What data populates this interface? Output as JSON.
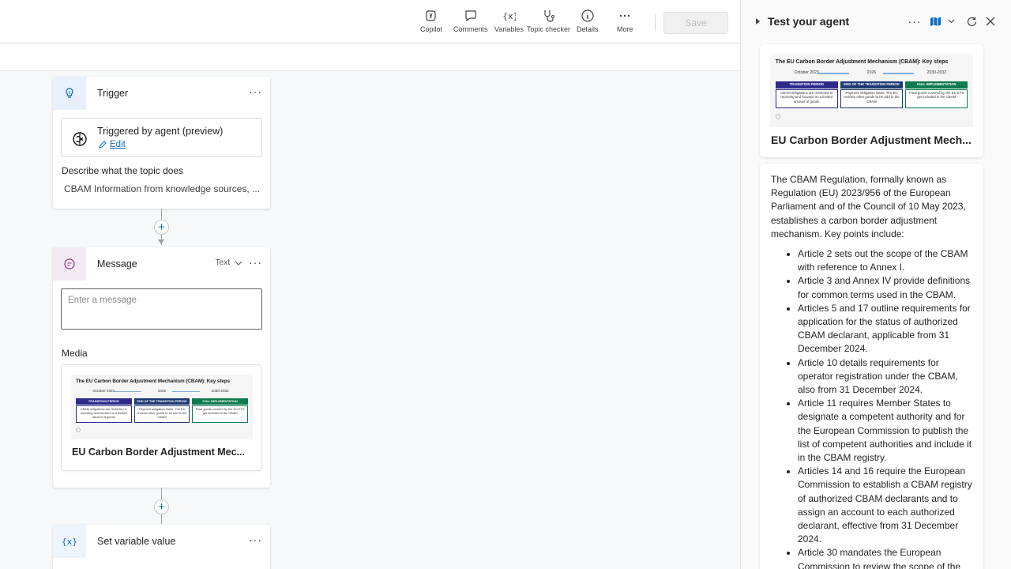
{
  "toolbar": {
    "copilot": "Copilot",
    "comments": "Comments",
    "variables": "Variables",
    "topic_checker": "Topic checker",
    "details": "Details",
    "more": "More",
    "save": "Save"
  },
  "trigger_node": {
    "title": "Trigger",
    "trigger_text": "Triggered by agent (preview)",
    "edit": "Edit",
    "desc_label": "Describe what the topic does",
    "desc_value": "CBAM Information from knowledge sources, ..."
  },
  "message_node": {
    "title": "Message",
    "type_select": "Text",
    "placeholder": "Enter a message",
    "media_label": "Media",
    "media_title": "EU Carbon Border Adjustment Mec..."
  },
  "setvar_node": {
    "title": "Set variable value"
  },
  "infographic": {
    "title": "The EU Carbon Border Adjustment Mechanism (CBAM): Key steps",
    "dates": [
      "October 2023",
      "2026",
      "2030-2032"
    ],
    "phases": [
      {
        "name": "TRANSITION PERIOD",
        "color": "#2e2a8c",
        "text": "CBAM obligations are restricted to reporting and focused on a limited amount of goods"
      },
      {
        "name": "END OF THE TRANSITION PERIOD",
        "color": "#1f3a73",
        "text": "Payment obligation starts. The EU reviews other goods to be add to the CBAM"
      },
      {
        "name": "FULL IMPLEMENTATION",
        "color": "#0e7a4f",
        "text": "Final goods covered by the EU ETS get included in the CBAM"
      }
    ]
  },
  "panel": {
    "title": "Test your agent",
    "card_title": "EU Carbon Border Adjustment Mech...",
    "intro": "The CBAM Regulation, formally known as Regulation (EU) 2023/956 of the European Parliament and of the Council of 10 May 2023, establishes a carbon border adjustment mechanism. Key points include:",
    "bullets": [
      "Article 2 sets out the scope of the CBAM with reference to Annex I.",
      "Article 3 and Annex IV provide definitions for common terms used in the CBAM.",
      "Articles 5 and 17 outline requirements for application for the status of authorized CBAM declarant, applicable from 31 December 2024.",
      "Article 10 details requirements for operator registration under the CBAM, also from 31 December 2024.",
      "Article 11 requires Member States to designate a competent authority and for the European Commission to publish the list of competent authorities and include it in the CBAM registry.",
      "Articles 14 and 16 require the European Commission to establish a CBAM registry of authorized CBAM declarants and to assign an account to each authorized declarant, effective from 31 December 2024.",
      "Article 30 mandates the European Commission to review the scope of the"
    ]
  }
}
